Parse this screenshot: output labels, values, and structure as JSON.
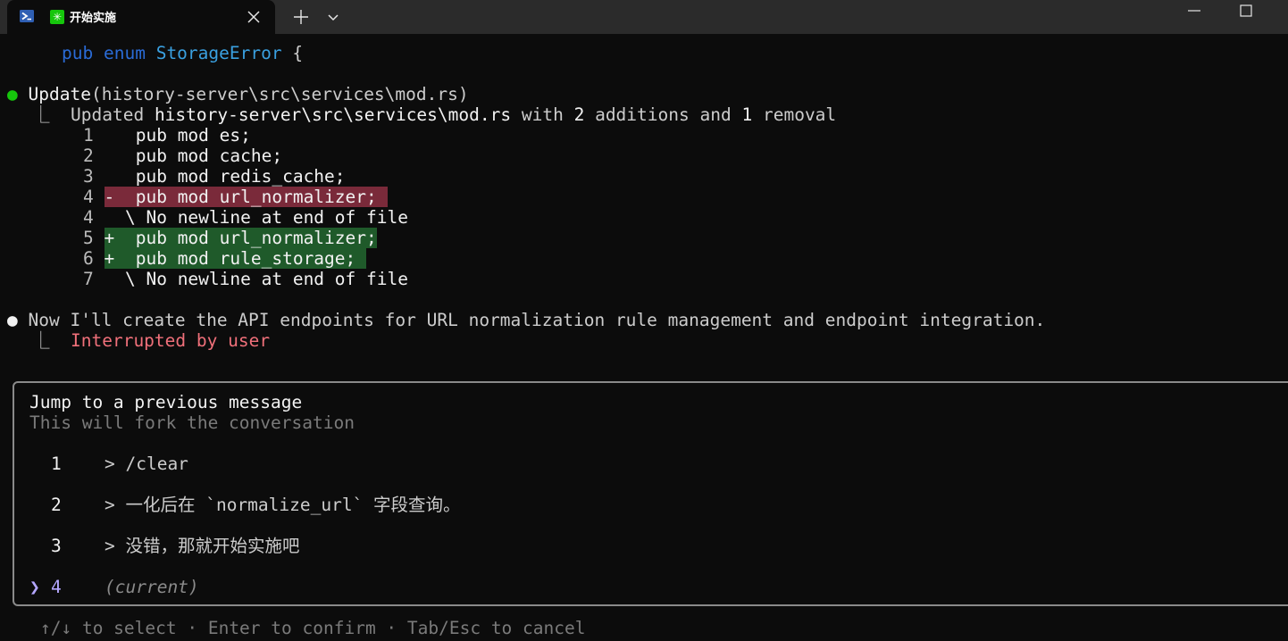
{
  "window": {
    "tab_title": "开始实施",
    "icons": {
      "shell": "powershell-icon",
      "app": "app-star-icon",
      "close": "close-icon",
      "new_tab": "plus-icon",
      "dropdown": "chevron-down-icon",
      "minimize": "minimize-icon",
      "maximize": "maximize-icon"
    }
  },
  "terminal": {
    "enum_line": {
      "kw1": "pub",
      "kw2": "enum",
      "type": "StorageError",
      "brace": " {"
    },
    "update": {
      "bullet": "●",
      "label": "Update",
      "path": "(history-server\\src\\services\\mod.rs)",
      "connector": "⎿",
      "summary_prefix": "Updated",
      "summary_path": "history-server\\src\\services\\mod.rs",
      "summary_with": "with",
      "additions_count": "2",
      "additions_word": "additions",
      "and_word": "and",
      "removals_count": "1",
      "removals_word": "removal"
    },
    "diff": [
      {
        "num": "1",
        "marker": " ",
        "code": "  pub mod es;",
        "kind": "ctx"
      },
      {
        "num": "2",
        "marker": " ",
        "code": "  pub mod cache;",
        "kind": "ctx"
      },
      {
        "num": "3",
        "marker": " ",
        "code": "  pub mod redis_cache;",
        "kind": "ctx"
      },
      {
        "num": "4",
        "marker": "-",
        "code": "  pub mod url_normalizer; ",
        "kind": "del"
      },
      {
        "num": "4",
        "marker": " ",
        "code": " \\ No newline at end of file",
        "kind": "ctx"
      },
      {
        "num": "5",
        "marker": "+",
        "code": "  pub mod url_normalizer;",
        "kind": "add"
      },
      {
        "num": "6",
        "marker": "+",
        "code": "  pub mod rule_storage; ",
        "kind": "add"
      },
      {
        "num": "7",
        "marker": " ",
        "code": " \\ No newline at end of file",
        "kind": "ctx"
      }
    ],
    "message": {
      "bullet": "●",
      "text": "Now I'll create the API endpoints for URL normalization rule management and endpoint integration.",
      "connector": "⎿",
      "status": "Interrupted by user"
    }
  },
  "dialog": {
    "title": "Jump to a previous message",
    "subtitle": "This will fork the conversation",
    "items": [
      {
        "num": "1",
        "text": "> /clear"
      },
      {
        "num": "2",
        "text": "> 一化后在 `normalize_url` 字段查询。"
      },
      {
        "num": "3",
        "text": "> 没错，那就开始实施吧"
      },
      {
        "num": "4",
        "text": "(current)",
        "pointer": "❯"
      }
    ],
    "footer": "↑/↓ to select · Enter to confirm · Tab/Esc to cancel"
  }
}
